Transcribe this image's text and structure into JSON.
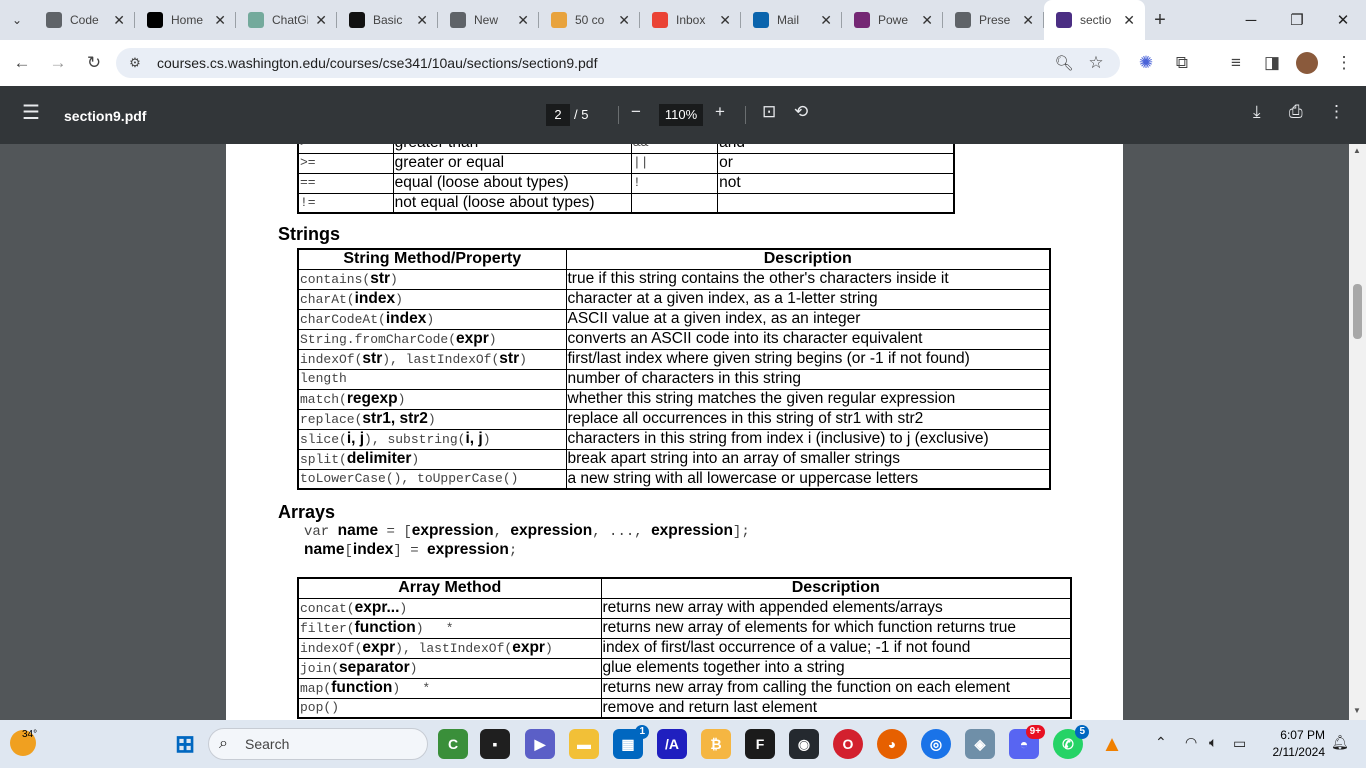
{
  "browser": {
    "tabs": [
      {
        "label": "Code",
        "icon": "globe-icon",
        "color": "#5f6368"
      },
      {
        "label": "Home",
        "icon": "x-logo-icon",
        "color": "#000000"
      },
      {
        "label": "ChatGPT",
        "icon": "chatgpt-icon",
        "color": "#74aa9c"
      },
      {
        "label": "Basic",
        "icon": "app-icon",
        "color": "#111111"
      },
      {
        "label": "New",
        "icon": "globe-icon",
        "color": "#5f6368"
      },
      {
        "label": "50 co",
        "icon": "image-icon",
        "color": "#e8a33d"
      },
      {
        "label": "Inbox",
        "icon": "gmail-icon",
        "color": "#ea4335"
      },
      {
        "label": "Mail",
        "icon": "outlook-icon",
        "color": "#0a64ad"
      },
      {
        "label": "Powe",
        "icon": "power-apps-icon",
        "color": "#742774"
      },
      {
        "label": "Prese",
        "icon": "globe-icon",
        "color": "#5f6368"
      },
      {
        "label": "sectio",
        "icon": "uw-icon",
        "color": "#4b2e83"
      }
    ],
    "url": "courses.cs.washington.edu/courses/cse341/10au/sections/section9.pdf"
  },
  "pdf": {
    "title": "section9.pdf",
    "page": "2",
    "total": "/ 5",
    "zoom": "110%"
  },
  "operators": {
    "rows": [
      [
        ">",
        "greater than",
        "&&",
        "and"
      ],
      [
        ">=",
        "greater or equal",
        "||",
        "or"
      ],
      [
        "==",
        "equal (loose about types)",
        "!",
        "not"
      ],
      [
        "!=",
        "not equal (loose about types)",
        "",
        ""
      ]
    ]
  },
  "strings": {
    "heading": "Strings",
    "col1": "String Method/Property",
    "col2": "Description",
    "rows": [
      {
        "m": "contains(",
        "a": "str",
        "e": ")",
        "d": "true if this string contains the other's characters inside it"
      },
      {
        "m": "charAt(",
        "a": "index",
        "e": ")",
        "d": "character at a given index, as a 1-letter string"
      },
      {
        "m": "charCodeAt(",
        "a": "index",
        "e": ")",
        "d": "ASCII value at a given index, as an integer"
      },
      {
        "m": "String.fromCharCode(",
        "a": "expr",
        "e": ")",
        "d": "converts an ASCII code into its character equivalent"
      },
      {
        "m": "indexOf(",
        "a": "str",
        "e": "), lastIndexOf(",
        "a2": "str",
        "e2": ")",
        "d": "first/last index where given string begins (or -1 if not found)"
      },
      {
        "m": "length",
        "a": "",
        "e": "",
        "d": "number of characters in this string"
      },
      {
        "m": "match(",
        "a": "regexp",
        "e": ")",
        "d": "whether this string matches the given regular expression"
      },
      {
        "m": "replace(",
        "a": "str1, str2",
        "e": ")",
        "d": "replace all occurrences in this string of str1 with str2"
      },
      {
        "m": "slice(",
        "a": "i, j",
        "e": "), substring(",
        "a2": "i, j",
        "e2": ")",
        "d": "characters in this string from index i (inclusive) to j (exclusive)"
      },
      {
        "m": "split(",
        "a": "delimiter",
        "e": ")",
        "d": "break apart string into an array of smaller strings"
      },
      {
        "m": "toLowerCase(), toUpperCase()",
        "a": "",
        "e": "",
        "d": "a new string with all lowercase or uppercase letters"
      }
    ]
  },
  "arrays": {
    "heading": "Arrays",
    "code1": {
      "kw": "var ",
      "name": "name",
      "mid": " = [",
      "e1": "expression",
      ",": ", ",
      "e2": "expression",
      "dots": ", ..., ",
      "e3": "expression",
      "end": "];"
    },
    "code2": {
      "name": "name",
      "lb": "[",
      "idx": "index",
      "rb": "] = ",
      "expr": "expression",
      "end": ";"
    },
    "col1": "Array Method",
    "col2": "Description",
    "rows": [
      {
        "m": "concat(",
        "a": "expr...",
        "e": ")",
        "star": "",
        "d": "returns new array with appended elements/arrays"
      },
      {
        "m": "filter(",
        "a": "function",
        "e": ")",
        "star": "*",
        "d": "returns new array of elements for which function returns true"
      },
      {
        "m": "indexOf(",
        "a": "expr",
        "e": "), lastIndexOf(",
        "a2": "expr",
        "e2": ")",
        "star": "",
        "d": "index of first/last occurrence of a value; -1 if not found"
      },
      {
        "m": "join(",
        "a": "separator",
        "e": ")",
        "star": "",
        "d": "glue elements together into a string"
      },
      {
        "m": "map(",
        "a": "function",
        "e": ")",
        "star": "*",
        "d": "returns new array from calling the function on each element"
      },
      {
        "m": "pop()",
        "a": "",
        "e": "",
        "star": "",
        "d": "remove and return last element"
      }
    ]
  },
  "taskbar": {
    "weather": "34°",
    "search": "Search",
    "time": "6:07 PM",
    "date": "2/11/2024",
    "badges": {
      "store": "1",
      "discord": "9+",
      "whatsapp": "5"
    }
  }
}
